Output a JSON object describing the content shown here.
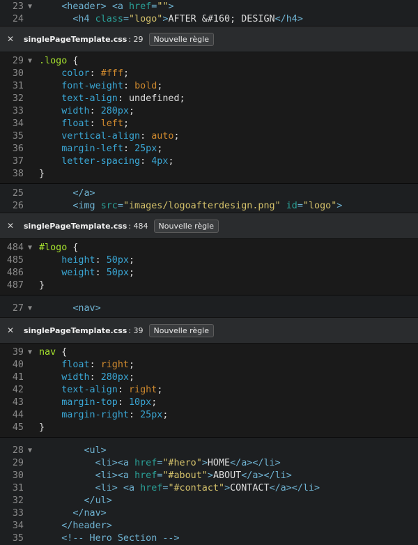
{
  "main_top": [
    {
      "n": "23",
      "fold": "▼",
      "tokens": [
        [
          "t-txt",
          "    "
        ],
        [
          "t-tag",
          "<header>"
        ],
        [
          "t-txt",
          " "
        ],
        [
          "t-tag",
          "<a "
        ],
        [
          "t-attr",
          "href"
        ],
        [
          "t-tag",
          "="
        ],
        [
          "t-str",
          "\"\""
        ],
        [
          "t-tag",
          ">"
        ]
      ]
    },
    {
      "n": "24",
      "fold": "",
      "tokens": [
        [
          "t-txt",
          "      "
        ],
        [
          "t-tag",
          "<h4 "
        ],
        [
          "t-attr",
          "class"
        ],
        [
          "t-tag",
          "="
        ],
        [
          "t-str",
          "\"logo\""
        ],
        [
          "t-tag",
          ">"
        ],
        [
          "t-txt",
          "AFTER &#160; DESIGN"
        ],
        [
          "t-tag",
          "</h4>"
        ]
      ]
    }
  ],
  "inline1": {
    "file": "singlePageTemplate.css",
    "line": ": 29",
    "button": "Nouvelle règle",
    "lines": [
      {
        "n": "29",
        "fold": "▼",
        "tokens": [
          [
            "t-sel",
            ".logo"
          ],
          [
            "t-def",
            " {"
          ]
        ]
      },
      {
        "n": "30",
        "fold": "",
        "tokens": [
          [
            "t-txt",
            "    "
          ],
          [
            "t-prop",
            "color"
          ],
          [
            "t-def",
            ": "
          ],
          [
            "t-val",
            "#fff"
          ],
          [
            "t-def",
            ";"
          ]
        ]
      },
      {
        "n": "31",
        "fold": "",
        "tokens": [
          [
            "t-txt",
            "    "
          ],
          [
            "t-prop",
            "font-weight"
          ],
          [
            "t-def",
            ": "
          ],
          [
            "t-val",
            "bold"
          ],
          [
            "t-def",
            ";"
          ]
        ]
      },
      {
        "n": "32",
        "fold": "",
        "tokens": [
          [
            "t-txt",
            "    "
          ],
          [
            "t-prop",
            "text-align"
          ],
          [
            "t-def",
            ": "
          ],
          [
            "t-plain",
            "undefined"
          ],
          [
            "t-def",
            ";"
          ]
        ]
      },
      {
        "n": "33",
        "fold": "",
        "tokens": [
          [
            "t-txt",
            "    "
          ],
          [
            "t-prop",
            "width"
          ],
          [
            "t-def",
            ": "
          ],
          [
            "t-num",
            "280px"
          ],
          [
            "t-def",
            ";"
          ]
        ]
      },
      {
        "n": "34",
        "fold": "",
        "tokens": [
          [
            "t-txt",
            "    "
          ],
          [
            "t-prop",
            "float"
          ],
          [
            "t-def",
            ": "
          ],
          [
            "t-val",
            "left"
          ],
          [
            "t-def",
            ";"
          ]
        ]
      },
      {
        "n": "35",
        "fold": "",
        "tokens": [
          [
            "t-txt",
            "    "
          ],
          [
            "t-prop",
            "vertical-align"
          ],
          [
            "t-def",
            ": "
          ],
          [
            "t-val",
            "auto"
          ],
          [
            "t-def",
            ";"
          ]
        ]
      },
      {
        "n": "36",
        "fold": "",
        "tokens": [
          [
            "t-txt",
            "    "
          ],
          [
            "t-prop",
            "margin-left"
          ],
          [
            "t-def",
            ": "
          ],
          [
            "t-num",
            "25px"
          ],
          [
            "t-def",
            ";"
          ]
        ]
      },
      {
        "n": "37",
        "fold": "",
        "tokens": [
          [
            "t-txt",
            "    "
          ],
          [
            "t-prop",
            "letter-spacing"
          ],
          [
            "t-def",
            ": "
          ],
          [
            "t-num",
            "4px"
          ],
          [
            "t-def",
            ";"
          ]
        ]
      },
      {
        "n": "38",
        "fold": "",
        "tokens": [
          [
            "t-def",
            "}"
          ]
        ]
      }
    ]
  },
  "main_mid1": [
    {
      "n": "25",
      "fold": "",
      "tokens": [
        [
          "t-txt",
          "      "
        ],
        [
          "t-tag",
          "</a>"
        ]
      ]
    },
    {
      "n": "26",
      "fold": "",
      "tokens": [
        [
          "t-txt",
          "      "
        ],
        [
          "t-tag",
          "<img "
        ],
        [
          "t-attr",
          "src"
        ],
        [
          "t-tag",
          "="
        ],
        [
          "t-str",
          "\"images/logoafterdesign.png\""
        ],
        [
          "t-txt",
          " "
        ],
        [
          "t-attr",
          "id"
        ],
        [
          "t-tag",
          "="
        ],
        [
          "t-str",
          "\"logo\""
        ],
        [
          "t-tag",
          ">"
        ]
      ]
    }
  ],
  "inline2": {
    "file": "singlePageTemplate.css",
    "line": ": 484",
    "button": "Nouvelle règle",
    "lines": [
      {
        "n": "484",
        "fold": "▼",
        "tokens": [
          [
            "t-sel",
            "#logo"
          ],
          [
            "t-def",
            " {"
          ]
        ]
      },
      {
        "n": "485",
        "fold": "",
        "tokens": [
          [
            "t-txt",
            "    "
          ],
          [
            "t-prop",
            "height"
          ],
          [
            "t-def",
            ": "
          ],
          [
            "t-num",
            "50px"
          ],
          [
            "t-def",
            ";"
          ]
        ]
      },
      {
        "n": "486",
        "fold": "",
        "tokens": [
          [
            "t-txt",
            "    "
          ],
          [
            "t-prop",
            "weight"
          ],
          [
            "t-def",
            ": "
          ],
          [
            "t-num",
            "50px"
          ],
          [
            "t-def",
            ";"
          ]
        ]
      },
      {
        "n": "487",
        "fold": "",
        "tokens": [
          [
            "t-def",
            "}"
          ]
        ]
      }
    ]
  },
  "main_mid2": [
    {
      "n": "27",
      "fold": "▼",
      "tokens": [
        [
          "t-txt",
          "      "
        ],
        [
          "t-tag",
          "<nav>"
        ]
      ]
    }
  ],
  "inline3": {
    "file": "singlePageTemplate.css",
    "line": ": 39",
    "button": "Nouvelle règle",
    "lines": [
      {
        "n": "39",
        "fold": "▼",
        "tokens": [
          [
            "t-sel",
            "nav"
          ],
          [
            "t-def",
            " {"
          ]
        ]
      },
      {
        "n": "40",
        "fold": "",
        "tokens": [
          [
            "t-txt",
            "    "
          ],
          [
            "t-prop",
            "float"
          ],
          [
            "t-def",
            ": "
          ],
          [
            "t-val",
            "right"
          ],
          [
            "t-def",
            ";"
          ]
        ]
      },
      {
        "n": "41",
        "fold": "",
        "tokens": [
          [
            "t-txt",
            "    "
          ],
          [
            "t-prop",
            "width"
          ],
          [
            "t-def",
            ": "
          ],
          [
            "t-num",
            "280px"
          ],
          [
            "t-def",
            ";"
          ]
        ]
      },
      {
        "n": "42",
        "fold": "",
        "tokens": [
          [
            "t-txt",
            "    "
          ],
          [
            "t-prop",
            "text-align"
          ],
          [
            "t-def",
            ": "
          ],
          [
            "t-val",
            "right"
          ],
          [
            "t-def",
            ";"
          ]
        ]
      },
      {
        "n": "43",
        "fold": "",
        "tokens": [
          [
            "t-txt",
            "    "
          ],
          [
            "t-prop",
            "margin-top"
          ],
          [
            "t-def",
            ": "
          ],
          [
            "t-num",
            "10px"
          ],
          [
            "t-def",
            ";"
          ]
        ]
      },
      {
        "n": "44",
        "fold": "",
        "tokens": [
          [
            "t-txt",
            "    "
          ],
          [
            "t-prop",
            "margin-right"
          ],
          [
            "t-def",
            ": "
          ],
          [
            "t-num",
            "25px"
          ],
          [
            "t-def",
            ";"
          ]
        ]
      },
      {
        "n": "45",
        "fold": "",
        "tokens": [
          [
            "t-def",
            "}"
          ]
        ]
      }
    ]
  },
  "main_bottom": [
    {
      "n": "28",
      "fold": "▼",
      "tokens": [
        [
          "t-txt",
          "        "
        ],
        [
          "t-tag",
          "<ul>"
        ]
      ]
    },
    {
      "n": "29",
      "fold": "",
      "tokens": [
        [
          "t-txt",
          "          "
        ],
        [
          "t-tag",
          "<li><a "
        ],
        [
          "t-attr",
          "href"
        ],
        [
          "t-tag",
          "="
        ],
        [
          "t-str",
          "\"#hero\""
        ],
        [
          "t-tag",
          ">"
        ],
        [
          "t-txt",
          "HOME"
        ],
        [
          "t-tag",
          "</a></li>"
        ]
      ]
    },
    {
      "n": "30",
      "fold": "",
      "tokens": [
        [
          "t-txt",
          "          "
        ],
        [
          "t-tag",
          "<li><a "
        ],
        [
          "t-attr",
          "href"
        ],
        [
          "t-tag",
          "="
        ],
        [
          "t-str",
          "\"#about\""
        ],
        [
          "t-tag",
          ">"
        ],
        [
          "t-txt",
          "ABOUT"
        ],
        [
          "t-tag",
          "</a></li>"
        ]
      ]
    },
    {
      "n": "31",
      "fold": "",
      "tokens": [
        [
          "t-txt",
          "          "
        ],
        [
          "t-tag",
          "<li> <a "
        ],
        [
          "t-attr",
          "href"
        ],
        [
          "t-tag",
          "="
        ],
        [
          "t-str",
          "\"#contact\""
        ],
        [
          "t-tag",
          ">"
        ],
        [
          "t-txt",
          "CONTACT"
        ],
        [
          "t-tag",
          "</a></li>"
        ]
      ]
    },
    {
      "n": "32",
      "fold": "",
      "tokens": [
        [
          "t-txt",
          "        "
        ],
        [
          "t-tag",
          "</ul>"
        ]
      ]
    },
    {
      "n": "33",
      "fold": "",
      "tokens": [
        [
          "t-txt",
          "      "
        ],
        [
          "t-tag",
          "</nav>"
        ]
      ]
    },
    {
      "n": "34",
      "fold": "",
      "tokens": [
        [
          "t-txt",
          "    "
        ],
        [
          "t-tag",
          "</header>"
        ]
      ]
    },
    {
      "n": "35",
      "fold": "",
      "tokens": [
        [
          "t-txt",
          "    "
        ],
        [
          "t-tag",
          "<!-- Hero Section -->"
        ]
      ]
    }
  ],
  "icons": {
    "close": "close-icon",
    "fold": "fold-arrow-icon"
  },
  "close_glyph": "✕"
}
